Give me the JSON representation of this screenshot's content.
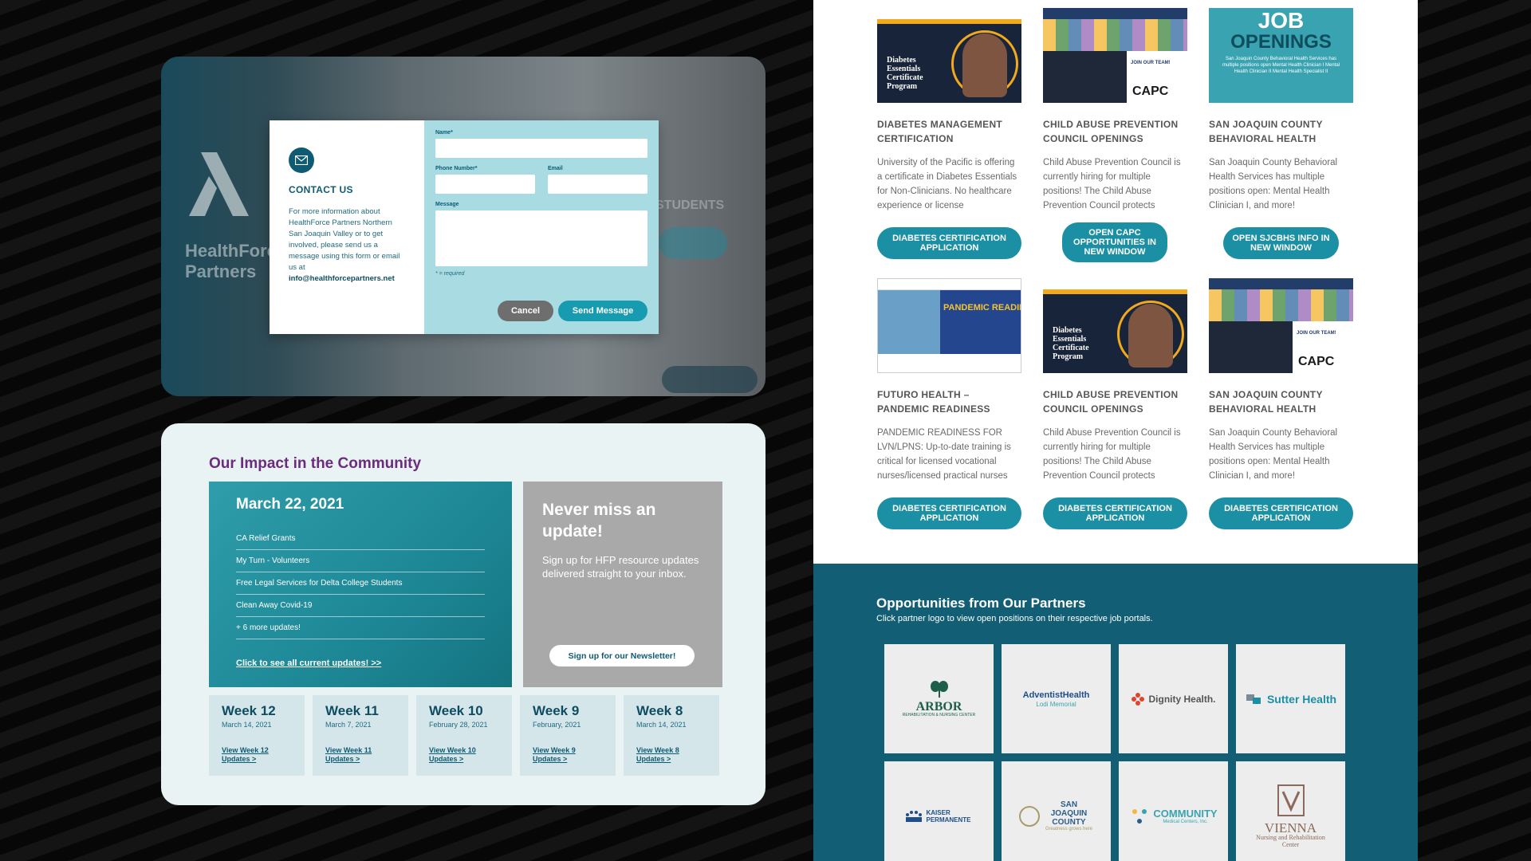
{
  "contact": {
    "bg_org_name": "HealthForce Partners",
    "bg_students": "STUDENTS",
    "title": "CONTACT US",
    "description": "For more information about HealthForce Partners Northern San Joaquin Valley or to get involved, please send us a message using this form or email us at",
    "email": "info@healthforcepartners.net",
    "fields": {
      "name_label": "Name*",
      "phone_label": "Phone Number*",
      "email_label": "Email",
      "message_label": "Message"
    },
    "required_note": "* = required",
    "cancel_label": "Cancel",
    "send_label": "Send Message"
  },
  "impact": {
    "title": "Our Impact in the Community",
    "update_date": "March 22, 2021",
    "updates": [
      "CA Relief Grants",
      "My Turn - Volunteers",
      "Free Legal Services for Delta College Students",
      "Clean Away Covid-19",
      "+ 6 more updates!"
    ],
    "all_updates_link": "Click to see all current updates! >>",
    "newsletter_title": "Never miss an update!",
    "newsletter_desc": "Sign up for HFP resource updates delivered straight to your inbox.",
    "newsletter_button": "Sign up for our Newsletter!",
    "weeks": [
      {
        "title": "Week 12",
        "date": "March 14, 2021",
        "link": "View Week 12 Updates >"
      },
      {
        "title": "Week 11",
        "date": "March 7, 2021",
        "link": "View Week 11 Updates >"
      },
      {
        "title": "Week 10",
        "date": "February 28, 2021",
        "link": "View Week 10 Updates >"
      },
      {
        "title": "Week 9",
        "date": "February, 2021",
        "link": "View Week 9 Updates >"
      },
      {
        "title": "Week 8",
        "date": "March 14, 2021",
        "link": "View Week 8 Updates >"
      }
    ]
  },
  "jobs": [
    {
      "title": "DIABETES MANAGEMENT CERTIFICATION",
      "desc": "University of the Pacific is offering a certificate in Diabetes Essentials for Non-Clinicians. No healthcare experience or license",
      "button": "DIABETES CERTIFICATION APPLICATION",
      "thumb_text": "Diabetes Essentials Certificate Program"
    },
    {
      "title": "CHILD ABUSE PREVENTION COUNCIL OPENINGS",
      "desc": "Child Abuse Prevention Council is currently hiring for multiple positions! The Child Abuse Prevention Council protects",
      "button": "OPEN CAPC OPPORTUNITIES IN NEW WINDOW",
      "thumb_text": "JOIN OUR TEAM!",
      "thumb_logo": "CAPC"
    },
    {
      "title": "SAN JOAQUIN COUNTY BEHAVIORAL HEALTH",
      "desc": "San Joaquin County Behavioral Health Services has multiple positions open: Mental Health Clinician I, and more!",
      "button": "OPEN SJCBHS INFO IN NEW WINDOW",
      "thumb_title1": "JOB",
      "thumb_title2": "OPENINGS",
      "thumb_text": "San Joaquin County Behavioral Health Services has multiple positions open Mental Health Clinician I Mental Health Clinician II Mental Health Specialist II"
    },
    {
      "title": "FUTURO HEALTH – PANDEMIC READINESS",
      "desc": "PANDEMIC READINESS FOR LVN/LPNS: Up-to-date training is critical for licensed vocational nurses/licensed practical nurses",
      "button": "DIABETES CERTIFICATION APPLICATION",
      "thumb_text": "PANDEMIC READINESS"
    },
    {
      "title": "CHILD ABUSE PREVENTION COUNCIL OPENINGS",
      "desc": "Child Abuse Prevention Council is currently hiring for multiple positions! The Child Abuse Prevention Council protects",
      "button": "DIABETES CERTIFICATION APPLICATION",
      "thumb_text": "Diabetes Essentials Certificate Program"
    },
    {
      "title": "SAN JOAQUIN COUNTY BEHAVIORAL HEALTH",
      "desc": "San Joaquin County Behavioral Health Services has multiple positions open: Mental Health Clinician I, and more!",
      "button": "DIABETES CERTIFICATION APPLICATION",
      "thumb_text": "JOIN OUR TEAM!",
      "thumb_logo": "CAPC"
    }
  ],
  "partners": {
    "title": "Opportunities from Our Partners",
    "subtitle": "Click partner logo to view open positions on their respective job portals.",
    "logos": [
      {
        "name": "ARBOR",
        "sub": "REHABILITATION & NURSING CENTER",
        "color": "#1f5e4a"
      },
      {
        "name": "AdventistHealth",
        "sub": "Lodi Memorial",
        "color": "#1f4e8c"
      },
      {
        "name": "Dignity Health.",
        "sub": "",
        "color": "#555555"
      },
      {
        "name": "Sutter Health",
        "sub": "",
        "color": "#1b8fa3"
      },
      {
        "name": "KAISER PERMANENTE",
        "sub": "",
        "color": "#1f4e8c"
      },
      {
        "name": "SAN JOAQUIN COUNTY",
        "sub": "Greatness grows here",
        "color": "#2a5d8a"
      },
      {
        "name": "COMMUNITY",
        "sub": "Medical Centers, Inc.",
        "color": "#3aa3b1"
      },
      {
        "name": "VIENNA",
        "sub": "Nursing and Rehabilitation Center",
        "color": "#8a6a5a"
      }
    ]
  }
}
